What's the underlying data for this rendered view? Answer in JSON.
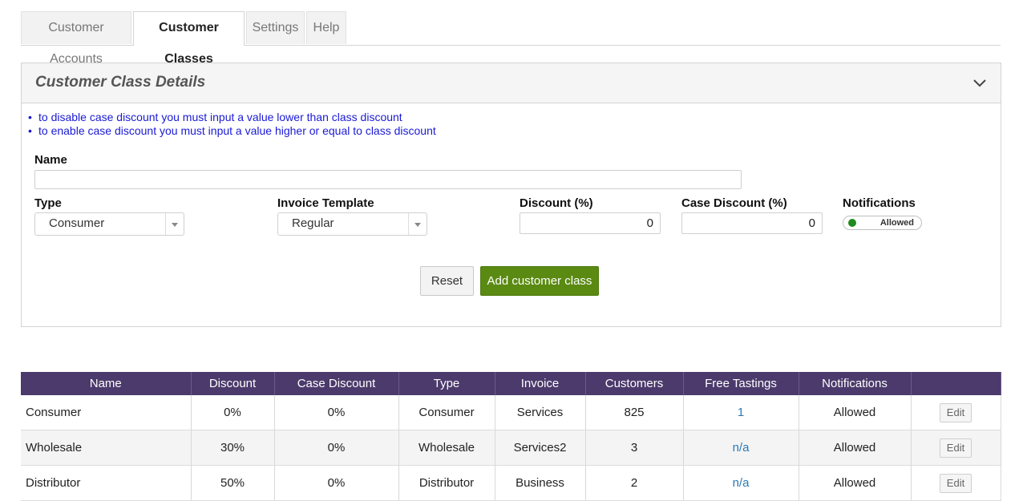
{
  "tabs": [
    {
      "label": "Customer Accounts"
    },
    {
      "label": "Customer Classes"
    },
    {
      "label": "Settings"
    },
    {
      "label": "Help"
    }
  ],
  "panel": {
    "title": "Customer Class Details",
    "notes": [
      "to disable case discount you must input a value lower than class discount",
      "to enable case discount you must input a value higher or equal to class discount"
    ]
  },
  "form": {
    "name_label": "Name",
    "name_value": "",
    "type_label": "Type",
    "type_value": "Consumer",
    "invoice_label": "Invoice Template",
    "invoice_value": "Regular",
    "discount_label": "Discount (%)",
    "discount_value": "0",
    "case_discount_label": "Case Discount (%)",
    "case_discount_value": "0",
    "notifications_label": "Notifications",
    "notifications_value": "Allowed",
    "reset_label": "Reset",
    "add_label": "Add customer class"
  },
  "table": {
    "headers": [
      "Name",
      "Discount",
      "Case Discount",
      "Type",
      "Invoice",
      "Customers",
      "Free Tastings",
      "Notifications",
      ""
    ],
    "rows": [
      {
        "name": "Consumer",
        "discount": "0%",
        "case_discount": "0%",
        "type": "Consumer",
        "invoice": "Services",
        "customers": "825",
        "free_tastings": "1",
        "notifications": "Allowed",
        "action": "Edit"
      },
      {
        "name": "Wholesale",
        "discount": "30%",
        "case_discount": "0%",
        "type": "Wholesale",
        "invoice": "Services2",
        "customers": "3",
        "free_tastings": "n/a",
        "notifications": "Allowed",
        "action": "Edit"
      },
      {
        "name": "Distributor",
        "discount": "50%",
        "case_discount": "0%",
        "type": "Distributor",
        "invoice": "Business",
        "customers": "2",
        "free_tastings": "n/a",
        "notifications": "Allowed",
        "action": "Edit"
      }
    ]
  },
  "colors": {
    "header_purple": "#4b3a6b",
    "add_button_green": "#5a8a12",
    "note_blue": "#1a1ad6",
    "link_blue": "#2a7ab5",
    "toggle_on_green": "#1f8a1f"
  }
}
